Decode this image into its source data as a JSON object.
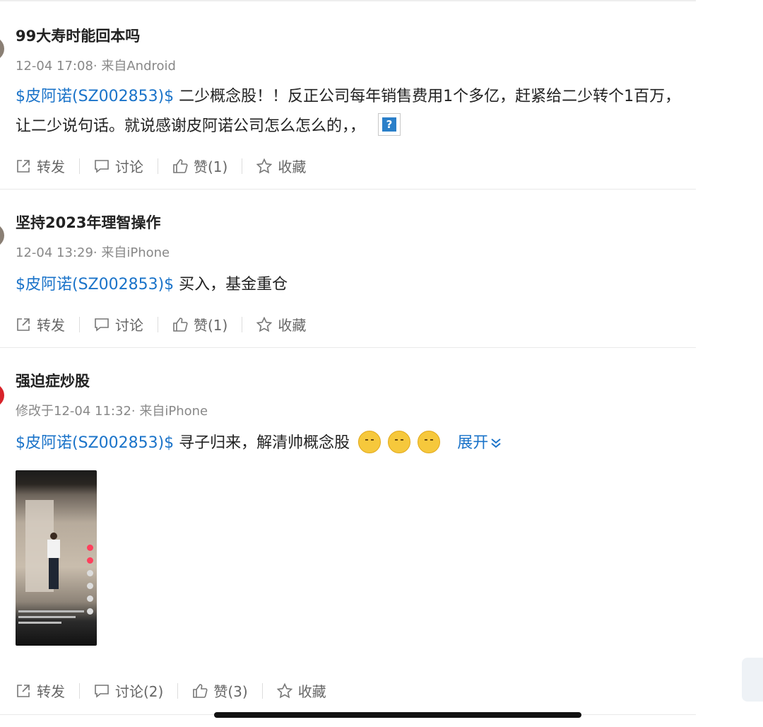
{
  "posts": [
    {
      "username": "99大寿时能回本吗",
      "meta": "12-04 17:08· 来自Android",
      "stock_tag": "$皮阿诺(SZ002853)$",
      "text": " 二少概念股！！反正公司每年销售费用1个多亿，赶紧给二少转个1百万，让二少说句话。就说感谢皮阿诺公司怎么怎么的，，",
      "image_placeholder_glyph": "?",
      "actions": {
        "repost": "转发",
        "discuss": "讨论",
        "like": "赞(1)",
        "favorite": "收藏"
      }
    },
    {
      "username": "坚持2023年理智操作",
      "meta": "12-04 13:29· 来自iPhone",
      "stock_tag": "$皮阿诺(SZ002853)$",
      "text": " 买入，基金重仓",
      "actions": {
        "repost": "转发",
        "discuss": "讨论",
        "like": "赞(1)",
        "favorite": "收藏"
      }
    },
    {
      "username": "强迫症炒股",
      "meta": "修改于12-04 11:32· 来自iPhone",
      "stock_tag": "$皮阿诺(SZ002853)$",
      "text": " 寻子归来，解清帅概念股",
      "expand": "展开",
      "actions": {
        "repost": "转发",
        "discuss": "讨论(2)",
        "like": "赞(3)",
        "favorite": "收藏"
      }
    }
  ],
  "colors": {
    "link": "#1a73c9",
    "meta": "#888888",
    "action": "#666666"
  }
}
